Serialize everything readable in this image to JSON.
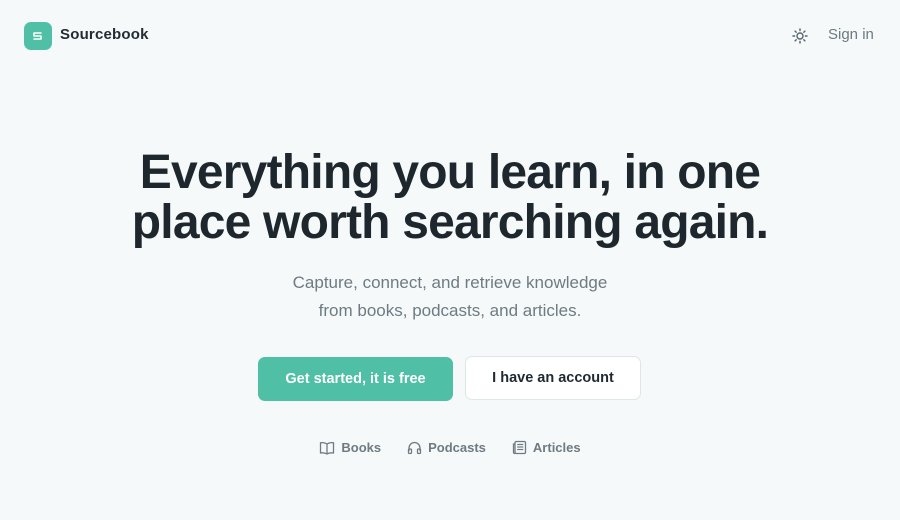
{
  "header": {
    "brand": "Sourcebook",
    "logo_icon": "sourcebook-logo",
    "theme_icon": "sun-icon",
    "signin_label": "Sign in"
  },
  "hero": {
    "title_line1": "Everything you learn, in one",
    "title_line2": "place worth searching again.",
    "subtitle_line1": "Capture, connect, and retrieve knowledge",
    "subtitle_line2": "from books, podcasts, and articles."
  },
  "actions": {
    "primary_label": "Get started, it is free",
    "secondary_label": "I have an account"
  },
  "sources": [
    {
      "label": "Books",
      "icon": "book-open-icon"
    },
    {
      "label": "Podcasts",
      "icon": "headphones-icon"
    },
    {
      "label": "Articles",
      "icon": "newspaper-icon"
    }
  ],
  "colors": {
    "accent": "#4fbfa5",
    "background": "#f6f9f9",
    "text": "#1f2a30",
    "muted": "#6e7b83"
  }
}
